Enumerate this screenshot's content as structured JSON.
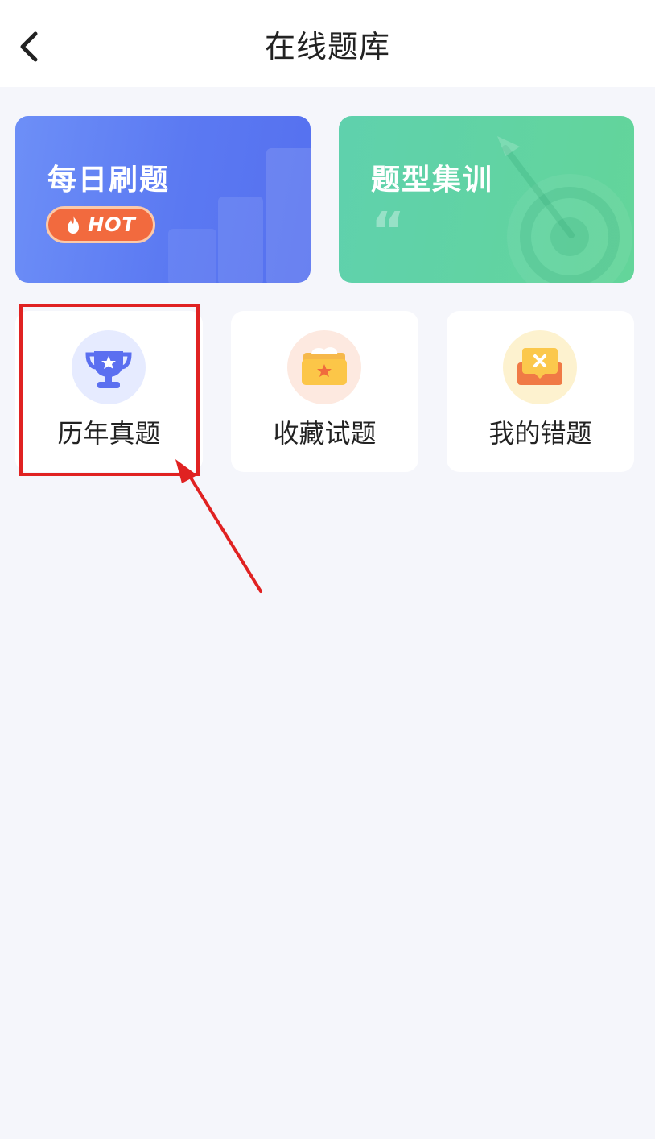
{
  "header": {
    "title": "在线题库",
    "back_icon": "chevron-left-icon"
  },
  "feature_cards": [
    {
      "title": "每日刷题",
      "badge": "HOT",
      "color": "#5b79f2"
    },
    {
      "title": "题型集训",
      "color": "#61d3a3"
    }
  ],
  "entries": [
    {
      "label": "历年真题",
      "icon": "trophy-icon",
      "icon_bg": "#e6ebff"
    },
    {
      "label": "收藏试题",
      "icon": "star-folder-icon",
      "icon_bg": "#fde9e0"
    },
    {
      "label": "我的错题",
      "icon": "wrong-message-icon",
      "icon_bg": "#fdf2cf"
    }
  ],
  "annotation": {
    "highlight_color": "#e02222",
    "target": "历年真题"
  }
}
